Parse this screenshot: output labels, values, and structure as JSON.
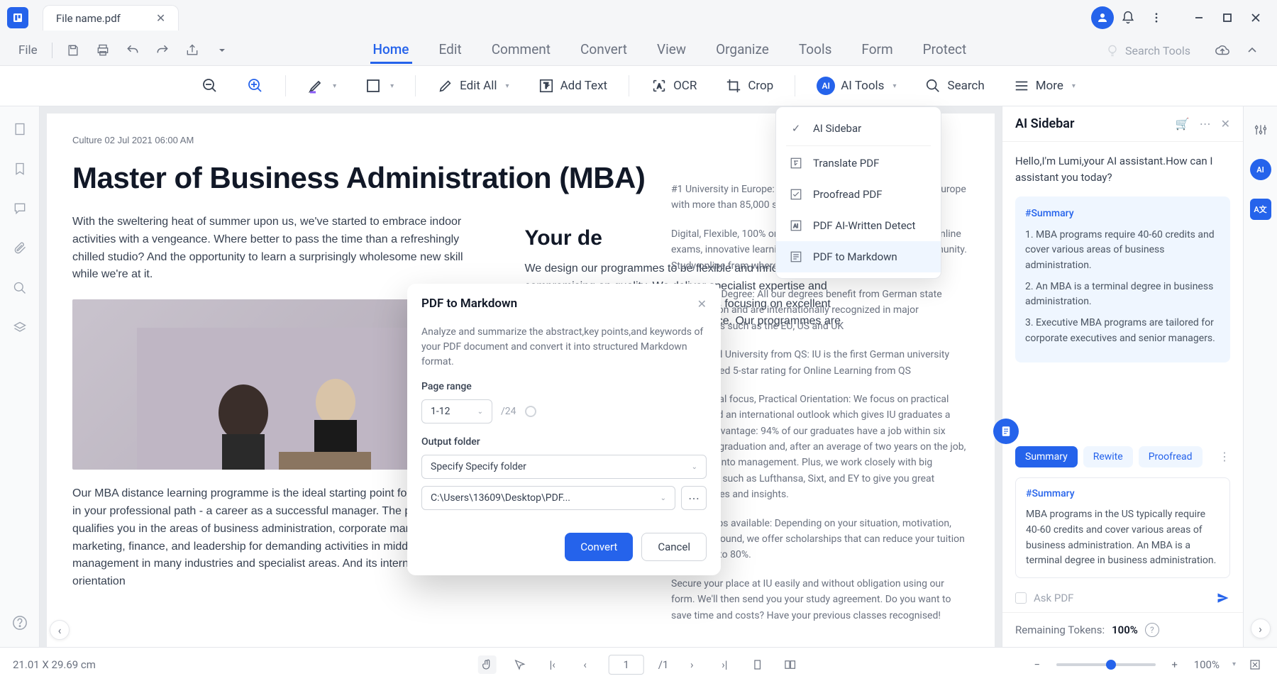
{
  "title_bar": {
    "file_name": "File name.pdf"
  },
  "menu": {
    "file": "File",
    "tabs": [
      "Home",
      "Edit",
      "Comment",
      "Convert",
      "View",
      "Organize",
      "Tools",
      "Form",
      "Protect"
    ],
    "active_tab": "Home",
    "search_placeholder": "Search Tools"
  },
  "ribbon": {
    "edit_all": "Edit All",
    "add_text": "Add Text",
    "ocr": "OCR",
    "crop": "Crop",
    "ai_tools": "AI Tools",
    "search": "Search",
    "more": "More"
  },
  "ai_menu": {
    "items": [
      {
        "label": "AI Sidebar",
        "checked": true
      },
      {
        "label": "Translate PDF"
      },
      {
        "label": "Proofread PDF"
      },
      {
        "label": "PDF AI-Written Detect"
      },
      {
        "label": "PDF to Markdown",
        "active": true
      }
    ]
  },
  "modal": {
    "title": "PDF to Markdown",
    "description": "Analyze and summarize the abstract,key points,and keywords of your PDF document and convert it into structured Markdown format.",
    "page_range_label": "Page range",
    "page_range_value": "1-12",
    "page_total": "/24",
    "output_folder_label": "Output folder",
    "output_option": "Specify Specify folder",
    "output_path": "C:\\Users\\13609\\Desktop\\PDF...",
    "convert": "Convert",
    "cancel": "Cancel"
  },
  "document": {
    "meta": "Culture 02 Jul 2021 06:00 AM",
    "title": "Master of Business Administration (MBA)",
    "intro": "With the sweltering heat of summer upon us, we've started to embrace indoor activities with a vengeance. Where better to pass the time than a refreshingly chilled studio? And the opportunity to learn a surprisingly wholesome new skill while we're at it.",
    "para2": "Our MBA distance learning programme is the ideal starting point for the next step in your professional path - a career as a successful manager. The programme qualifies you in the areas of business administration, corporate management, marketing, finance, and leadership for demanding activities in middle to upper management in many industries and specialist areas. And its international orientation",
    "h2": "Your de",
    "para3": "We design our programmes to be flexible and innovative, without compromising on quality. We deliver specialist expertise and innovative learning materials as well as focusing on excellent student services and professional advice. Our programmes are characterised by the effective",
    "r1": "#1 University in Europe: Join the largest private university in Europe with more than 85,000 students",
    "r2": "Digital, Flexible, 100% online: Fully flexible study model with online exams, innovative learning materials and a great online community. Study online from wherever you are with online exams 24/7.",
    "r3": "Accredited Degree: All our degrees benefit from German state accreditation and are internationally recognized in major jurisdictions such as the EU, US and UK",
    "r4": "5-Star rated University from QS: IU is the first German university that achieved 5-star rating for Online Learning from QS",
    "r5": "International focus, Practical Orientation: We focus on practical training and an international outlook which gives IU graduates a decisive advantage: 94% of our graduates have a job within six months of graduation and, after an average of two years on the job, 80% move into management. Plus, we work closely with big companies such as Lufthansa, Sixt, and EY to give you great opportunities and insights.",
    "r6": "Scholarships available: Depending on your situation, motivation, and background, we offer scholarships that can reduce your tuition fees by up to 80%.",
    "r7": "Secure your place at IU easily and without obligation using our form. We'll then send you your study agreement. Do you want to save time and costs? Have your previous classes recognised!"
  },
  "ai_sidebar": {
    "title": "AI Sidebar",
    "greeting": "Hello,I'm Lumi,your AI assistant.How can I assistant you today?",
    "summary_tag": "#Summary",
    "s1": "1. MBA programs require 40-60 credits and cover various areas of business administration.",
    "s2": "2. An MBA is a terminal degree in business administration.",
    "s3": "3. Executive MBA programs are tailored for corporate executives and senior managers.",
    "chips": {
      "summary": "Summary",
      "rewrite": "Rewite",
      "proofread": "Proofread"
    },
    "result_tag": "#Summary",
    "result_text": "MBA programs in the US typically require 40-60 credits and cover various areas of business administration. An MBA is a terminal degree in business administration.",
    "ask_placeholder": "Ask PDF",
    "tokens_label": "Remaining Tokens:",
    "tokens_value": "100%"
  },
  "status": {
    "dimensions": "21.01 X 29.69 cm",
    "page_current": "1",
    "page_total": "/1",
    "zoom": "100%"
  }
}
